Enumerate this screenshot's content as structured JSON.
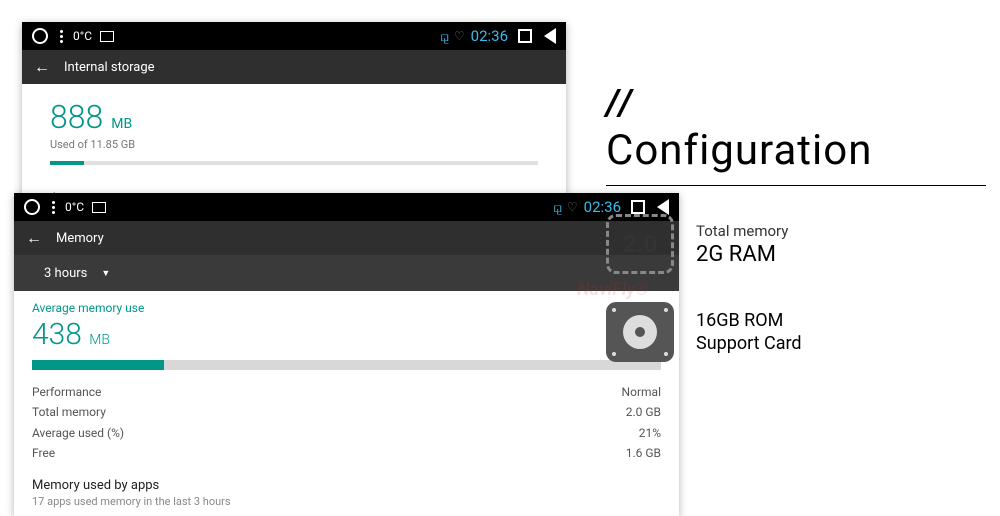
{
  "statusbar": {
    "temp": "0°C",
    "time": "02:36"
  },
  "shot1": {
    "header": "Internal storage",
    "value": "888",
    "unit": "MB",
    "used_of": "Used of 11.85 GB",
    "apps": "Apps"
  },
  "shot2": {
    "header": "Memory",
    "dropdown": "3 hours",
    "watermark": "NaviFly®",
    "avg_label": "Average memory use",
    "value": "438",
    "unit": "MB",
    "stats": {
      "perf_label": "Performance",
      "perf_val": "Normal",
      "total_label": "Total memory",
      "total_val": "2.0 GB",
      "avg_label": "Average used (%)",
      "avg_val": "21%",
      "free_label": "Free",
      "free_val": "1.6 GB"
    },
    "mem_apps": "Memory used by apps",
    "mem_apps_sub": "17 apps used memory in the last 3 hours"
  },
  "right": {
    "slashes": "//",
    "title": "Configuration",
    "ram_badge": "2.0",
    "ram_label": "Total memory",
    "ram_value": "2G RAM",
    "rom_line1": "16GB ROM",
    "rom_line2": "Support Card"
  }
}
